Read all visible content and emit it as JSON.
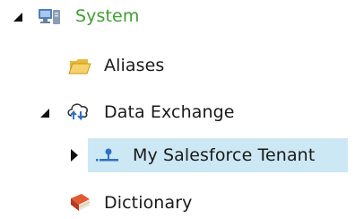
{
  "tree": {
    "items": [
      {
        "label": "System",
        "icon": "system-computer-icon",
        "expanded": true,
        "level": 0,
        "label_color": "#3f9f30"
      },
      {
        "label": "Aliases",
        "icon": "folder-icon",
        "level": 1
      },
      {
        "label": "Data Exchange",
        "icon": "data-exchange-cloud-icon",
        "expanded": true,
        "level": 1
      },
      {
        "label": "My Salesforce Tenant",
        "icon": "salesforce-tenant-icon",
        "expanded": false,
        "level": 2,
        "selected": true,
        "selected_bg": "#cce8f4"
      },
      {
        "label": "Dictionary",
        "icon": "book-icon",
        "level": 1
      }
    ]
  }
}
